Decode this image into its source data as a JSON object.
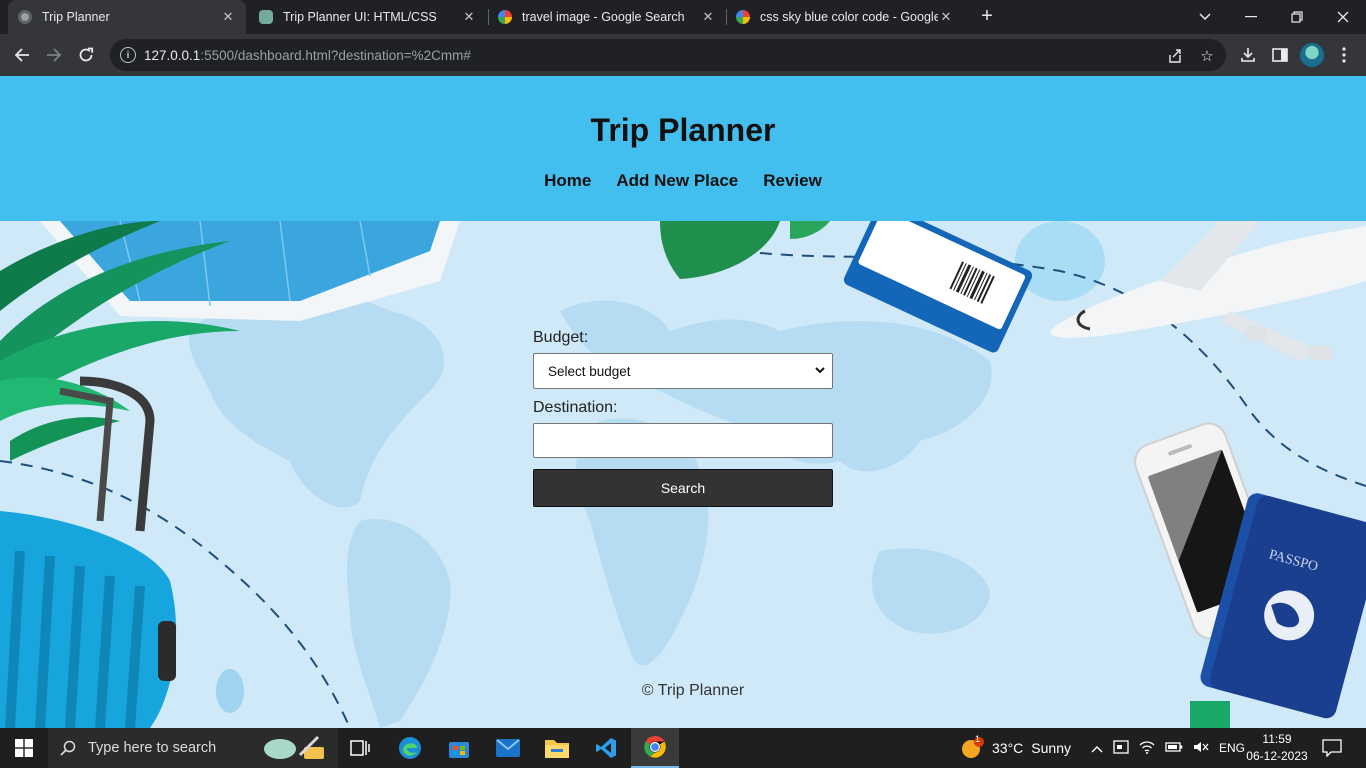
{
  "browser": {
    "tabs": [
      {
        "title": "Trip Planner",
        "icon": "globe-icon",
        "active": true
      },
      {
        "title": "Trip Planner UI: HTML/CSS",
        "icon": "chatgpt-icon",
        "active": false
      },
      {
        "title": "travel image - Google Search",
        "icon": "google-icon",
        "active": false
      },
      {
        "title": "css sky blue color code - Google",
        "icon": "google-icon",
        "active": false
      }
    ],
    "url_host": "127.0.0.1",
    "url_rest": ":5500/dashboard.html?destination=%2Cmm#"
  },
  "site": {
    "title": "Trip Planner",
    "nav": [
      "Home",
      "Add New Place",
      "Review"
    ],
    "header_color": "#43bfef"
  },
  "form": {
    "budget_label": "Budget:",
    "budget_selected": "Select budget",
    "destination_label": "Destination:",
    "destination_value": "",
    "search_label": "Search"
  },
  "footer": "© Trip Planner",
  "taskbar": {
    "search_placeholder": "Type here to search",
    "weather_temp": "33°C",
    "weather_text": "Sunny",
    "weather_badge": "1",
    "language": "ENG",
    "time": "11:59",
    "date": "06-12-2023"
  }
}
